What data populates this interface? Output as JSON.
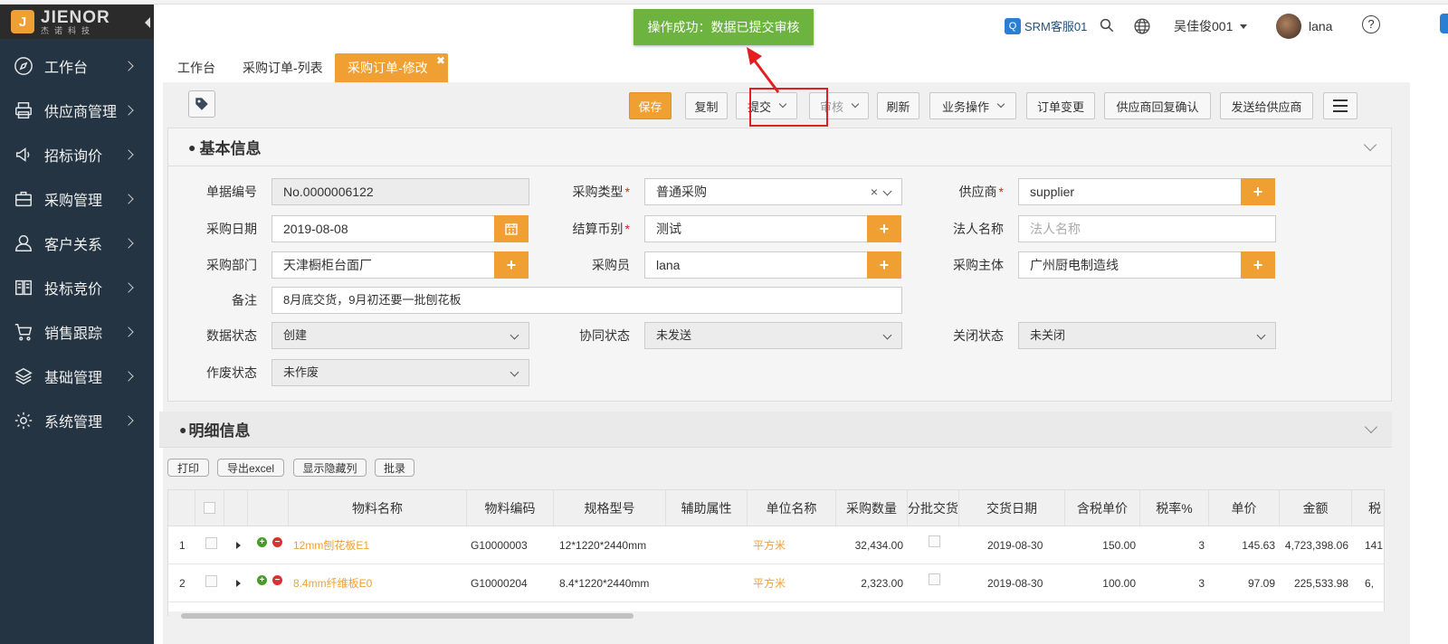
{
  "app": {
    "logo_text": "JIENOR",
    "logo_sub": "杰诺科技"
  },
  "sidebar": {
    "items": [
      {
        "label": "工作台",
        "icon": "compass-icon"
      },
      {
        "label": "供应商管理",
        "icon": "printer-icon"
      },
      {
        "label": "招标询价",
        "icon": "megaphone-icon"
      },
      {
        "label": "采购管理",
        "icon": "briefcase-icon"
      },
      {
        "label": "客户关系",
        "icon": "user-icon"
      },
      {
        "label": "投标竞价",
        "icon": "book-icon"
      },
      {
        "label": "销售跟踪",
        "icon": "cart-icon"
      },
      {
        "label": "基础管理",
        "icon": "layers-icon"
      },
      {
        "label": "系统管理",
        "icon": "gear-icon"
      }
    ]
  },
  "header": {
    "support": "SRM客服01",
    "account": "吴佳俊001",
    "username": "lana",
    "help": "?"
  },
  "toast": {
    "message": "操作成功：数据已提交审核"
  },
  "tabs": [
    {
      "label": "工作台"
    },
    {
      "label": "采购订单-列表"
    },
    {
      "label": "采购订单-修改",
      "active": true
    }
  ],
  "toolbar": {
    "save": "保存",
    "copy": "复制",
    "submit": "提交",
    "review": "审核",
    "refresh": "刷新",
    "business": "业务操作",
    "change": "订单变更",
    "confirm": "供应商回复确认",
    "send": "发送给供应商"
  },
  "basic": {
    "title": "基本信息",
    "doc_no_label": "单据编号",
    "doc_no": "No.0000006122",
    "type_label": "采购类型",
    "type": "普通采购",
    "supplier_label": "供应商",
    "supplier": "supplier",
    "date_label": "采购日期",
    "date": "2019-08-08",
    "currency_label": "结算币别",
    "currency": "测试",
    "legal_label": "法人名称",
    "legal_placeholder": "法人名称",
    "dept_label": "采购部门",
    "dept": "天津橱柜台面厂",
    "buyer_label": "采购员",
    "buyer": "lana",
    "entity_label": "采购主体",
    "entity": "广州厨电制造线",
    "remark_label": "备注",
    "remark": "8月底交货，9月初还要一批刨花板",
    "data_status_label": "数据状态",
    "data_status": "创建",
    "collab_label": "协同状态",
    "collab": "未发送",
    "close_label": "关闭状态",
    "close": "未关闭",
    "void_label": "作废状态",
    "void": "未作废"
  },
  "detail": {
    "title": "明细信息",
    "print": "打印",
    "export": "导出excel",
    "show_hidden": "显示隐藏列",
    "batch": "批录",
    "columns": [
      "物料名称",
      "物料编码",
      "规格型号",
      "辅助属性",
      "单位名称",
      "采购数量",
      "分批交货",
      "交货日期",
      "含税单价",
      "税率%",
      "单价",
      "金额",
      "税"
    ],
    "rows": [
      {
        "no": "1",
        "name": "12mm刨花板E1",
        "code": "G10000003",
        "spec": "12*1220*2440mm",
        "unit": "平方米",
        "qty": "32,434.00",
        "date": "2019-08-30",
        "taxprice": "150.00",
        "rate": "3",
        "price": "145.63",
        "amount": "4,723,398.06",
        "tax": "141,"
      },
      {
        "no": "2",
        "name": "8.4mm纤维板E0",
        "code": "G10000204",
        "spec": "8.4*1220*2440mm",
        "unit": "平方米",
        "qty": "2,323.00",
        "date": "2019-08-30",
        "taxprice": "100.00",
        "rate": "3",
        "price": "97.09",
        "amount": "225,533.98",
        "tax": "6,"
      }
    ]
  },
  "colors": {
    "accent": "#f0a033",
    "sidebar": "#243442",
    "toast": "#6db33f",
    "highlight": "#e02020"
  }
}
